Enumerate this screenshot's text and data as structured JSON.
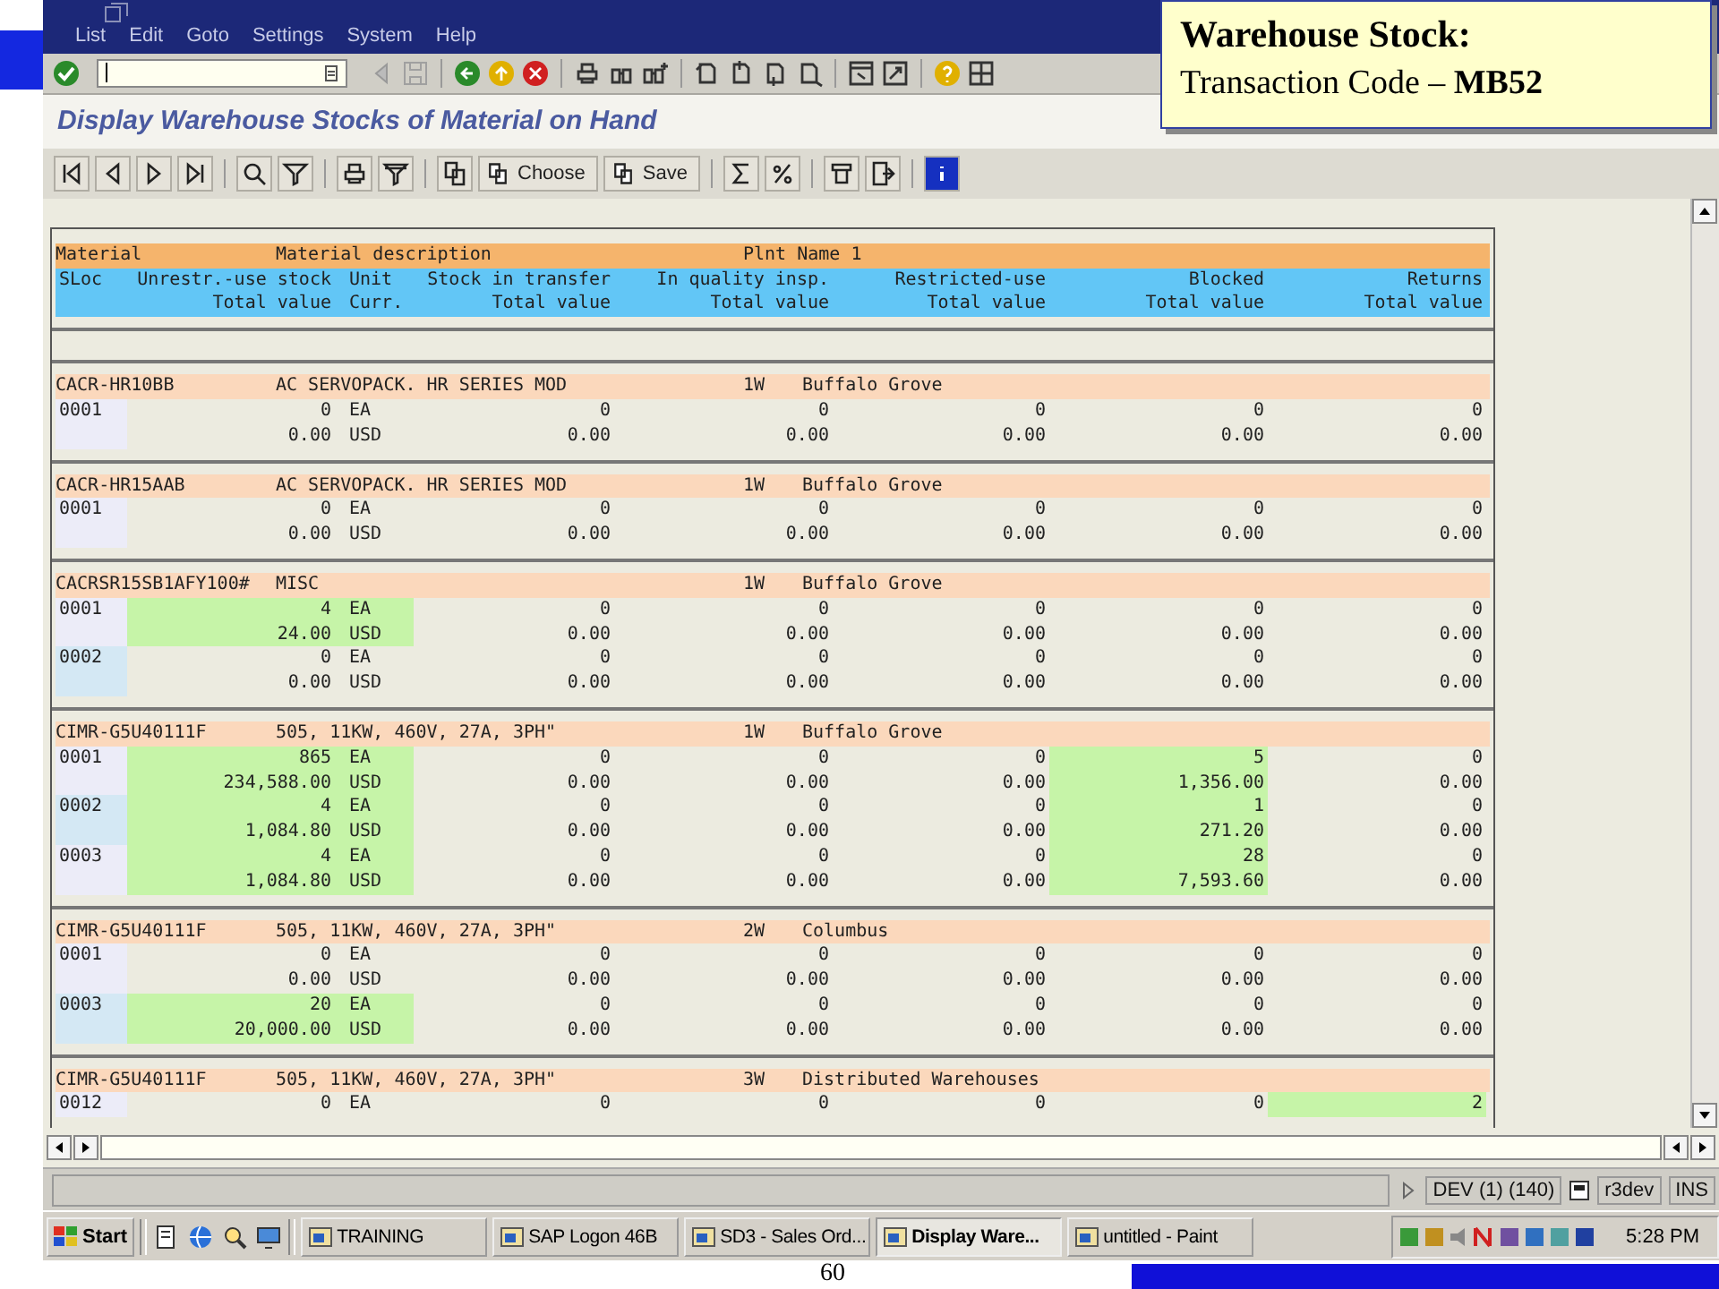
{
  "callout": {
    "title": "Warehouse Stock:",
    "subtitle": "Transaction Code – **MB52**"
  },
  "menu": [
    "List",
    "Edit",
    "Goto",
    "Settings",
    "System",
    "Help"
  ],
  "screen_title": "Display Warehouse Stocks of Material on Hand",
  "app_toolbar_buttons": [
    "Choose",
    "Save"
  ],
  "list": {
    "header": {
      "row_1": [
        "Material",
        "Material description",
        "Plnt Name 1"
      ],
      "row_2": [
        "SLoc",
        "Unrestr.-use stock",
        "Unit",
        "Stock in transfer",
        "In quality insp.",
        "Restricted-use",
        "Blocked",
        "Returns"
      ],
      "row_3": [
        "Total value",
        "Curr.",
        "Total value",
        "Total value",
        "Total value",
        "Total value",
        "Total value"
      ]
    },
    "groups": [
      {
        "material": "CACR-HR10BB",
        "description": "AC SERVOPACK. HR SERIES MOD",
        "plant": "1W",
        "plant_name": "Buffalo Grove",
        "slocs": [
          {
            "sloc": "0001",
            "qty": [
              "0",
              "EA",
              "0",
              "0",
              "0",
              "0",
              "0"
            ],
            "value": [
              "0.00",
              "USD",
              "0.00",
              "0.00",
              "0.00",
              "0.00",
              "0.00"
            ],
            "highlight": [
              false,
              false,
              false,
              false,
              false,
              false
            ]
          }
        ]
      },
      {
        "material": "CACR-HR15AAB",
        "description": "AC SERVOPACK. HR SERIES MOD",
        "plant": "1W",
        "plant_name": "Buffalo Grove",
        "slocs": [
          {
            "sloc": "0001",
            "qty": [
              "0",
              "EA",
              "0",
              "0",
              "0",
              "0",
              "0"
            ],
            "value": [
              "0.00",
              "USD",
              "0.00",
              "0.00",
              "0.00",
              "0.00",
              "0.00"
            ],
            "highlight": [
              false,
              false,
              false,
              false,
              false,
              false
            ]
          }
        ]
      },
      {
        "material": "CACRSR15SB1AFY100#",
        "description": "MISC",
        "plant": "1W",
        "plant_name": "Buffalo Grove",
        "slocs": [
          {
            "sloc": "0001",
            "qty": [
              "4",
              "EA",
              "0",
              "0",
              "0",
              "0",
              "0"
            ],
            "value": [
              "24.00",
              "USD",
              "0.00",
              "0.00",
              "0.00",
              "0.00",
              "0.00"
            ],
            "highlight": [
              true,
              false,
              false,
              false,
              false,
              false
            ]
          },
          {
            "sloc": "0002",
            "qty": [
              "0",
              "EA",
              "0",
              "0",
              "0",
              "0",
              "0"
            ],
            "value": [
              "0.00",
              "USD",
              "0.00",
              "0.00",
              "0.00",
              "0.00",
              "0.00"
            ],
            "highlight": [
              false,
              false,
              false,
              false,
              false,
              false
            ]
          }
        ]
      },
      {
        "material": "CIMR-G5U40111F",
        "description": "505, 11KW, 460V, 27A, 3PH\"",
        "plant": "1W",
        "plant_name": "Buffalo Grove",
        "slocs": [
          {
            "sloc": "0001",
            "qty": [
              "865",
              "EA",
              "0",
              "0",
              "0",
              "5",
              "0"
            ],
            "value": [
              "234,588.00",
              "USD",
              "0.00",
              "0.00",
              "0.00",
              "1,356.00",
              "0.00"
            ],
            "highlight": [
              true,
              false,
              false,
              false,
              true,
              false
            ]
          },
          {
            "sloc": "0002",
            "qty": [
              "4",
              "EA",
              "0",
              "0",
              "0",
              "1",
              "0"
            ],
            "value": [
              "1,084.80",
              "USD",
              "0.00",
              "0.00",
              "0.00",
              "271.20",
              "0.00"
            ],
            "highlight": [
              true,
              false,
              false,
              false,
              true,
              false
            ]
          },
          {
            "sloc": "0003",
            "qty": [
              "4",
              "EA",
              "0",
              "0",
              "0",
              "28",
              "0"
            ],
            "value": [
              "1,084.80",
              "USD",
              "0.00",
              "0.00",
              "0.00",
              "7,593.60",
              "0.00"
            ],
            "highlight": [
              true,
              false,
              false,
              false,
              true,
              false
            ]
          }
        ]
      },
      {
        "material": "CIMR-G5U40111F",
        "description": "505, 11KW, 460V, 27A, 3PH\"",
        "plant": "2W",
        "plant_name": "Columbus",
        "slocs": [
          {
            "sloc": "0001",
            "qty": [
              "0",
              "EA",
              "0",
              "0",
              "0",
              "0",
              "0"
            ],
            "value": [
              "0.00",
              "USD",
              "0.00",
              "0.00",
              "0.00",
              "0.00",
              "0.00"
            ],
            "highlight": [
              false,
              false,
              false,
              false,
              false,
              false
            ]
          },
          {
            "sloc": "0003",
            "qty": [
              "20",
              "EA",
              "0",
              "0",
              "0",
              "0",
              "0"
            ],
            "value": [
              "20,000.00",
              "USD",
              "0.00",
              "0.00",
              "0.00",
              "0.00",
              "0.00"
            ],
            "highlight": [
              true,
              false,
              false,
              false,
              false,
              false
            ]
          }
        ]
      },
      {
        "material": "CIMR-G5U40111F",
        "description": "505, 11KW, 460V, 27A, 3PH\"",
        "plant": "3W",
        "plant_name": "Distributed Warehouses",
        "slocs": [
          {
            "sloc": "0012",
            "qty": [
              "0",
              "EA",
              "0",
              "0",
              "0",
              "0",
              "2"
            ],
            "highlight": [
              false,
              false,
              false,
              false,
              false,
              true
            ]
          }
        ]
      }
    ]
  },
  "status_bar": [
    "DEV (1) (140)",
    "r3dev",
    "INS"
  ],
  "taskbar": {
    "start": "Start",
    "tasks": [
      {
        "label": "TRAINING",
        "selected": false
      },
      {
        "label": "SAP Logon 46B",
        "selected": false
      },
      {
        "label": "SD3 - Sales Ord...",
        "selected": false
      },
      {
        "label": "Display Ware...",
        "selected": true
      },
      {
        "label": "untitled - Paint",
        "selected": false
      }
    ],
    "clock": "5:28 PM"
  },
  "slide_number": "60"
}
